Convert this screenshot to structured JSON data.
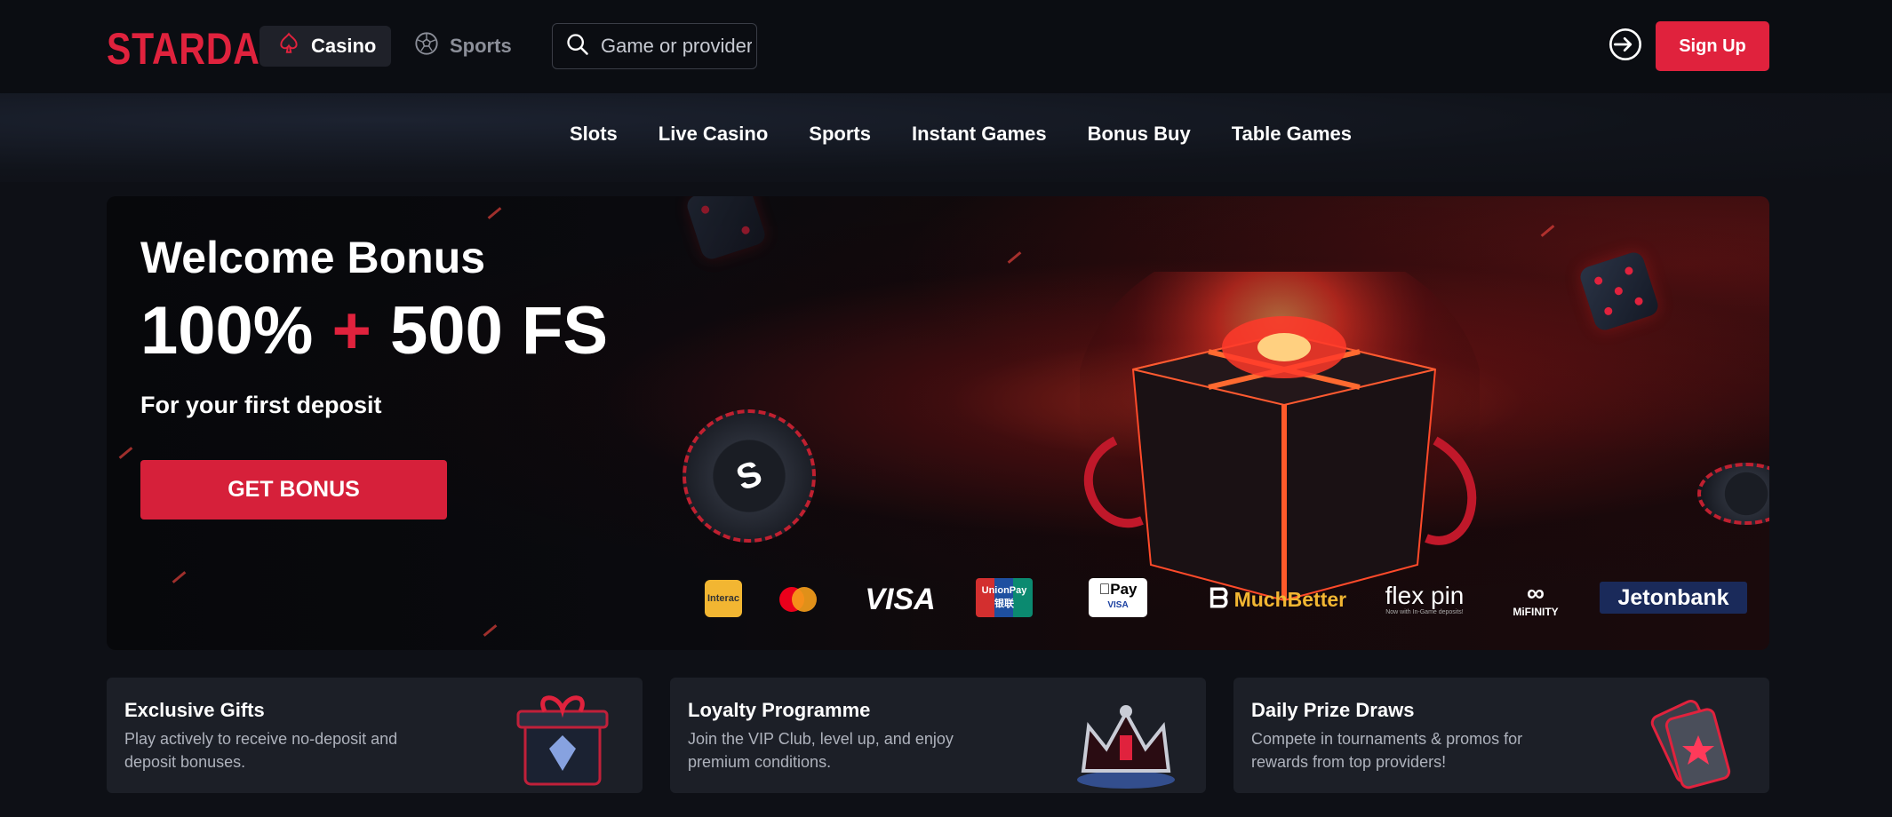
{
  "header": {
    "logo_text": "STARDA",
    "tabs": [
      {
        "label": "Casino",
        "icon": "spade-icon",
        "active": true
      },
      {
        "label": "Sports",
        "icon": "soccer-ball-icon",
        "active": false
      }
    ],
    "search_placeholder": "Game or provider",
    "signup_label": "Sign Up"
  },
  "nav": {
    "items": [
      "Slots",
      "Live Casino",
      "Sports",
      "Instant Games",
      "Bonus Buy",
      "Table Games"
    ]
  },
  "hero": {
    "title": "Welcome Bonus",
    "offer_left": "100%",
    "offer_plus": "+",
    "offer_right": "500 FS",
    "subtitle": "For your first deposit",
    "cta_label": "GET BONUS",
    "chip_letter": "S"
  },
  "payments": {
    "interac": "Interac",
    "visa": "VISA",
    "unionpay": "UnionPay",
    "unionpay_cn": "银联",
    "applepay": "Pay",
    "applepay_sub": "VISA",
    "muchbetter": "MuchBetter",
    "flexepin": "flex pin",
    "flexepin_sub": "Now with In-Game deposits!",
    "mifinity": "MiFINITY",
    "jetonbank": "Jetonbank"
  },
  "cards": [
    {
      "title": "Exclusive Gifts",
      "desc": "Play actively to receive no-deposit and deposit bonuses."
    },
    {
      "title": "Loyalty Programme",
      "desc": "Join the VIP Club, level up, and enjoy premium conditions."
    },
    {
      "title": "Daily Prize Draws",
      "desc": "Compete in tournaments & promos for rewards from top providers!"
    }
  ],
  "colors": {
    "accent": "#e0223d",
    "background": "#0e1016",
    "card": "#1c1f27"
  }
}
